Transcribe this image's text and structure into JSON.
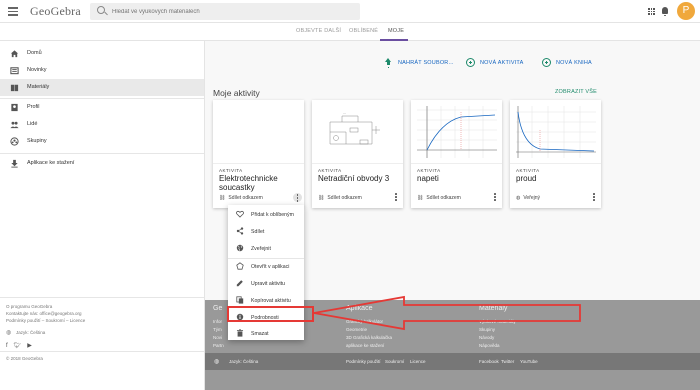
{
  "header": {
    "logo": "GeoGebra",
    "search_placeholder": "Hledat ve výukových materiálech",
    "avatar_letter": "P",
    "icons": [
      "menu-icon",
      "search-icon",
      "apps-icon",
      "bell-icon"
    ]
  },
  "tabs": [
    {
      "label": "OBJEVTE DALŠÍ",
      "active": false
    },
    {
      "label": "OBLÍBENÉ",
      "active": false
    },
    {
      "label": "MOJE",
      "active": true
    }
  ],
  "sidebar": {
    "items": [
      {
        "label": "Domů",
        "icon": "home-icon",
        "active": false
      },
      {
        "label": "Novinky",
        "icon": "news-icon",
        "active": false
      },
      {
        "label": "Materiály",
        "icon": "materials-icon",
        "active": true
      },
      {
        "label": "Profil",
        "icon": "profile-icon",
        "active": false
      },
      {
        "label": "Lidé",
        "icon": "people-icon",
        "active": false
      },
      {
        "label": "Skupiny",
        "icon": "groups-icon",
        "active": false
      }
    ],
    "download": {
      "label": "Aplikace ke stažení",
      "icon": "download-icon"
    },
    "about": "O programu GeoGebra",
    "contact": "Kontaktujte nás: office@geogebra.org",
    "terms": "Podmínky použití – Soukromí – Licence",
    "language": "Jazyk: Čeština",
    "copyright": "© 2018 GeoGebra"
  },
  "actions": {
    "upload": "NAHRÁT SOUBOR...",
    "new_activity": "NOVÁ AKTIVITA",
    "new_book": "NOVÁ KNIHA"
  },
  "section": {
    "title": "Moje aktivity",
    "show_all": "ZOBRAZIT VŠE"
  },
  "cards": [
    {
      "kind": "AKTIVITA",
      "title": "Elektrotechnicke soucastky",
      "share": "Sdílet odkazem",
      "share_icon": "link-icon"
    },
    {
      "kind": "AKTIVITA",
      "title": "Netradiční obvody 3",
      "share": "Sdílet odkazem",
      "share_icon": "link-icon"
    },
    {
      "kind": "AKTIVITA",
      "title": "napeti",
      "share": "Sdílet odkazem",
      "share_icon": "link-icon"
    },
    {
      "kind": "AKTIVITA",
      "title": "proud",
      "share": "Veřejný",
      "share_icon": "globe-icon"
    }
  ],
  "context_menu": {
    "items": [
      {
        "label": "Přidat k oblíbeným",
        "icon": "heart-icon"
      },
      {
        "label": "Sdílet",
        "icon": "share-icon"
      },
      {
        "label": "Zveřejnit",
        "icon": "globe-icon"
      },
      {
        "label": "Otevřít v aplikaci",
        "icon": "open-in-app-icon"
      },
      {
        "label": "Upravit aktivitu",
        "icon": "pencil-icon"
      },
      {
        "label": "Kopírovat aktivitu",
        "icon": "copy-icon"
      },
      {
        "label": "Podrobnosti",
        "icon": "info-icon"
      },
      {
        "label": "Smazat",
        "icon": "trash-icon"
      }
    ],
    "highlighted": "Podrobnosti",
    "highlight_color": "#e53935"
  },
  "footer": {
    "col1_head": "Ge",
    "col1_links": [
      "Infor",
      "Tým",
      "Novi",
      "Partn"
    ],
    "col2_head": "Aplikace",
    "col2_links": [
      "Grafický kalkulátor",
      "Geometrie",
      "3D Grafická kalkulačka",
      "aplikace ke stažení"
    ],
    "col3_head": "Materiály",
    "col3_links": [
      "Výukové materiály",
      "Skupiny",
      "Návody",
      "Nápověda"
    ],
    "language": "Jazyk: Čeština",
    "legal": [
      "Podmínky použití",
      "Soukromí",
      "Licence"
    ],
    "social": [
      "Facebook",
      "Twitter",
      "YouTube"
    ]
  },
  "colors": {
    "accent": "#1e8a6b",
    "tab_underline": "#6a4ea0",
    "avatar": "#f0a83c",
    "link_blue": "#1565c0"
  }
}
